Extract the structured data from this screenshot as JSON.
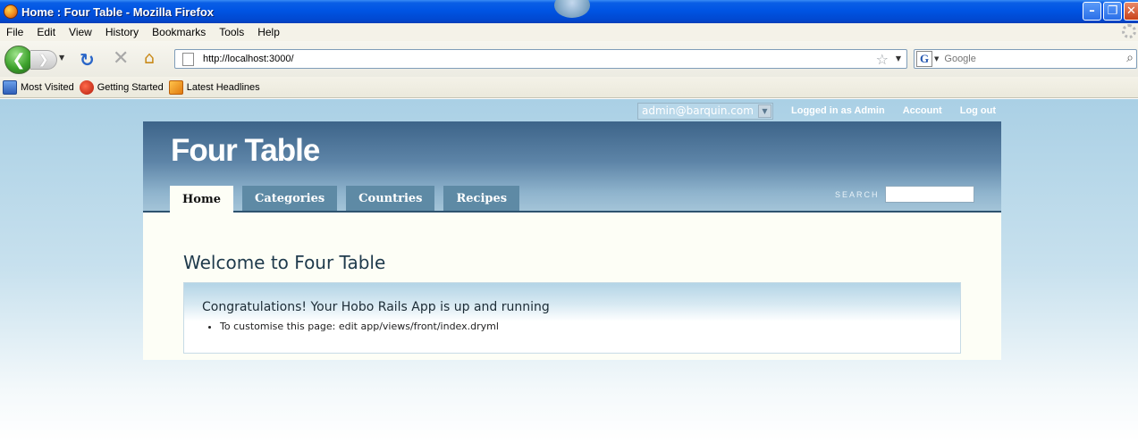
{
  "window": {
    "title": "Home : Four Table - Mozilla Firefox",
    "minimize": "–",
    "maximize": "❐",
    "close": "✕"
  },
  "menu": {
    "items": [
      "File",
      "Edit",
      "View",
      "History",
      "Bookmarks",
      "Tools",
      "Help"
    ]
  },
  "toolbar": {
    "back_glyph": "❮",
    "forward_glyph": "❯",
    "dropdown_glyph": "▼",
    "reload_glyph": "↻",
    "stop_glyph": "✕",
    "home_glyph": "⌂",
    "url": "http://localhost:3000/",
    "star_glyph": "☆",
    "search_engine_letter": "G",
    "search_placeholder": "Google",
    "magnifier_glyph": "⌕"
  },
  "bookmarks": {
    "items": [
      "Most Visited",
      "Getting Started",
      "Latest Headlines"
    ]
  },
  "page": {
    "account_nav": {
      "user_select_value": "admin@barquin.com",
      "select_arrow": "▼",
      "logged_in_text": "Logged in as Admin",
      "account_link": "Account",
      "logout_link": "Log out"
    },
    "app_name": "Four Table",
    "nav_tabs": [
      "Home",
      "Categories",
      "Countries",
      "Recipes"
    ],
    "current_tab": "Home",
    "search_label": "SEARCH",
    "heading": "Welcome to Four Table",
    "panel": {
      "heading": "Congratulations! Your Hobo Rails App is up and running",
      "items": [
        "To customise this page: edit app/views/front/index.dryml"
      ]
    }
  },
  "colors": {
    "title_bar": "#0054e3",
    "header_dark": "#3d6489",
    "tab_bg": "#5e8aa5",
    "content_bg": "#fdfef6"
  }
}
